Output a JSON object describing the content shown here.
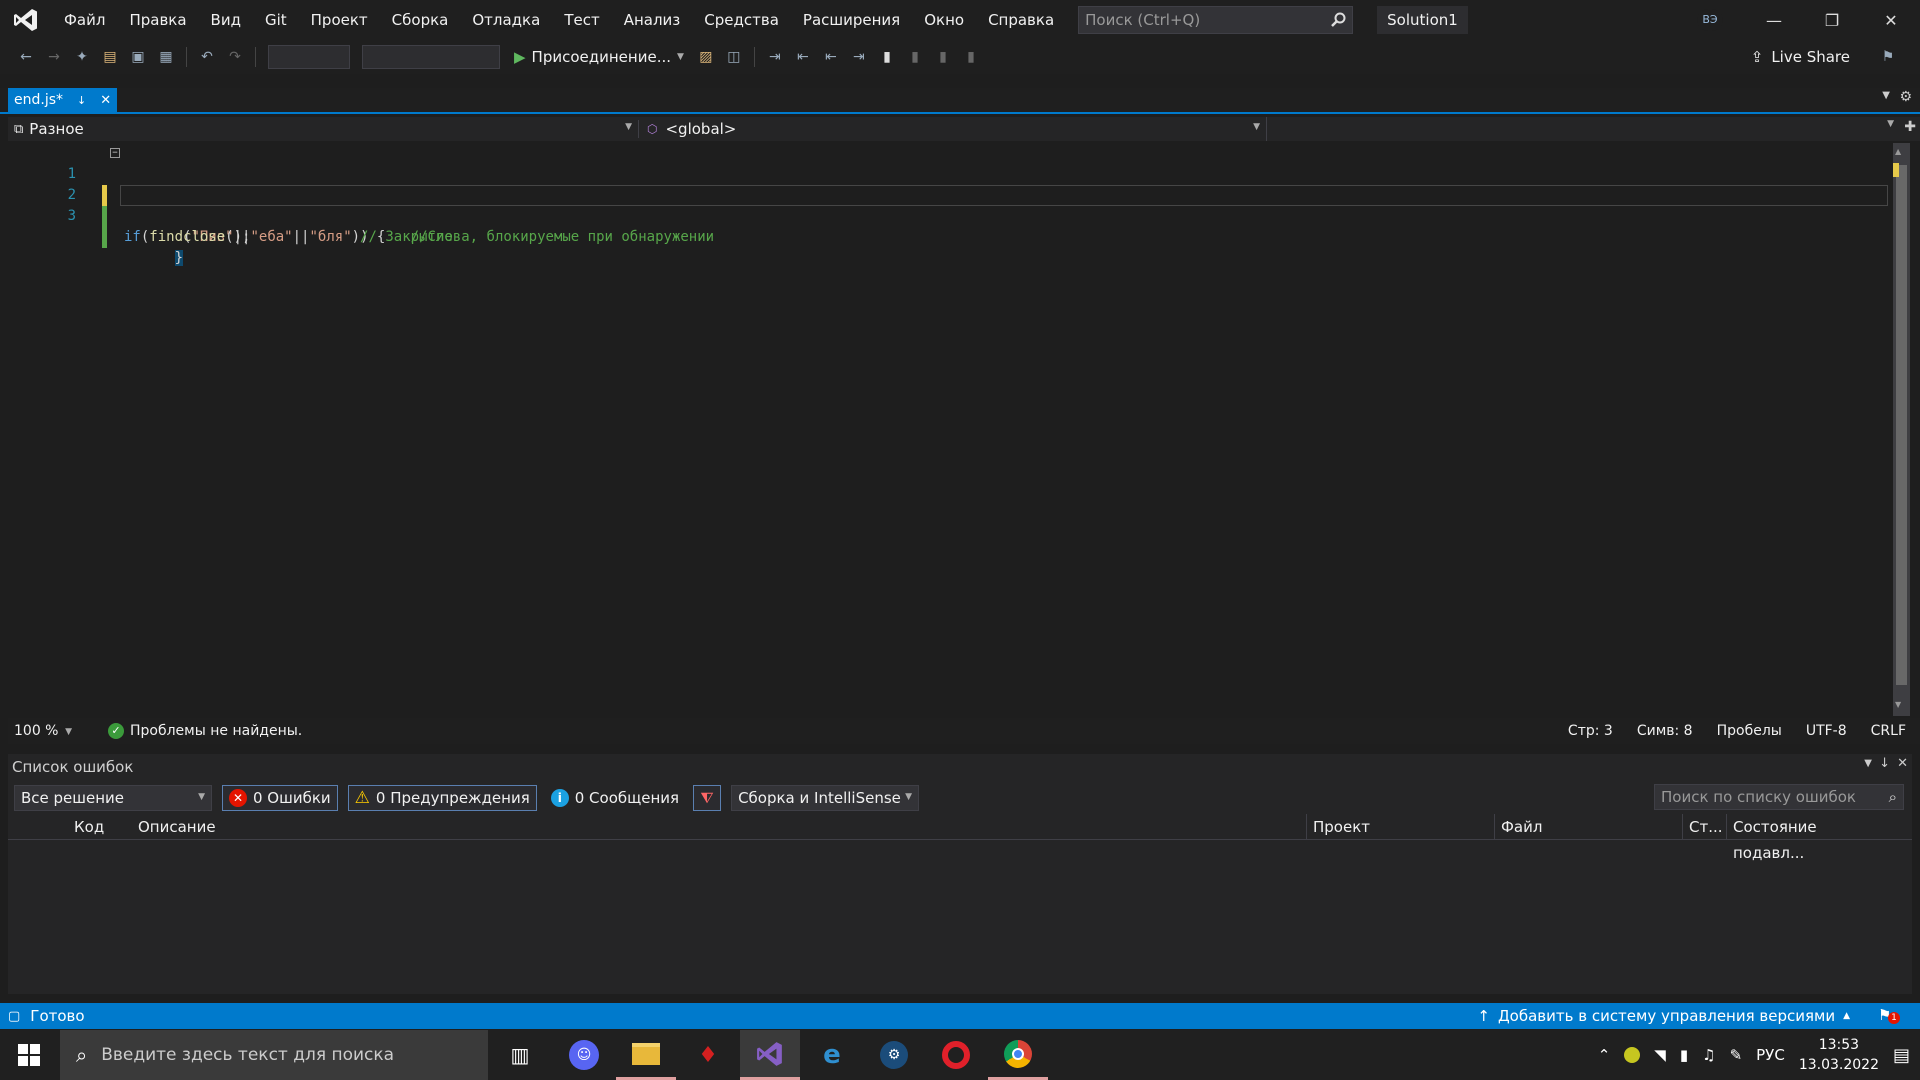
{
  "menu": [
    "Файл",
    "Правка",
    "Вид",
    "Git",
    "Проект",
    "Сборка",
    "Отладка",
    "Тест",
    "Анализ",
    "Средства",
    "Расширения",
    "Окно",
    "Справка"
  ],
  "search": {
    "placeholder": "Поиск (Ctrl+Q)"
  },
  "solution_name": "Solution1",
  "avatar_initials": "ВЭ",
  "toolbar": {
    "attach_label": "Присоединение...",
    "live_share_label": "Live Share"
  },
  "tab": {
    "title": "end.js*"
  },
  "nav": {
    "project": "Разное",
    "scope": "<global>"
  },
  "editor": {
    "line_numbers": [
      "1",
      "2",
      "3"
    ],
    "line1": {
      "kw": "if",
      "p1": "(",
      "fn": "find",
      "p2": "(",
      "s1": "\"Пиз\"",
      "o1": "||",
      "s2": "\"еба\"",
      "o2": "||",
      "s3": "\"бля\"",
      "p3": ")) {",
      "comment": "//Слова, блокируемые при обнаружении"
    },
    "line2": {
      "fn": "close",
      "rest": "();",
      "comment": "// Закрытие"
    },
    "line3": {
      "brace": "}"
    }
  },
  "editor_status": {
    "zoom": "100 %",
    "problems": "Проблемы не найдены.",
    "line": "Стр: 3",
    "col": "Симв: 8",
    "indent": "Пробелы",
    "encoding": "UTF-8",
    "eol": "CRLF"
  },
  "error_list": {
    "title": "Список ошибок",
    "scope": "Все решение",
    "errors": "0 Ошибки",
    "warnings": "0 Предупреждения",
    "messages": "0 Сообщения",
    "build_filter": "Сборка и IntelliSense",
    "search_placeholder": "Поиск по списку ошибок",
    "columns": [
      "Код",
      "Описание",
      "Проект",
      "Файл",
      "Ст...",
      "Состояние подавл..."
    ]
  },
  "status": {
    "ready": "Готово",
    "vcs": "Добавить в систему управления версиями",
    "notif_count": "1"
  },
  "taskbar": {
    "search_placeholder": "Введите здесь текст для поиска",
    "lang": "РУС",
    "time": "13:53",
    "date": "13.03.2022"
  },
  "colors": {
    "accent": "#007acc",
    "vs_purple": "#865fc5",
    "comment_green": "#57a64a",
    "string_brown": "#d69d85",
    "keyword_blue": "#569cd6"
  }
}
